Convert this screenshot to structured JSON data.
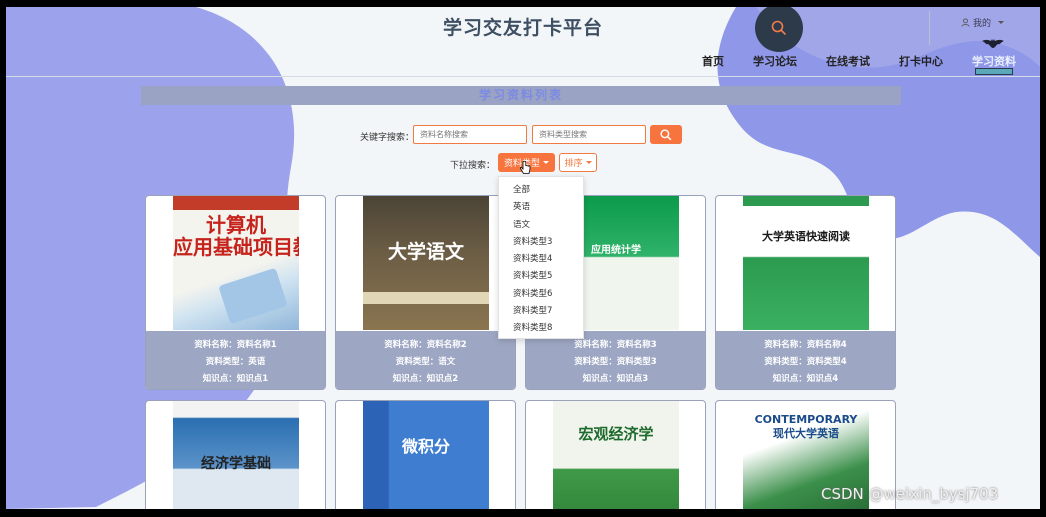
{
  "site_title": "学习交友打卡平台",
  "user_menu": {
    "label": "我的"
  },
  "nav": [
    {
      "label": "首页",
      "active": false
    },
    {
      "label": "学习论坛",
      "active": false
    },
    {
      "label": "在线考试",
      "active": false
    },
    {
      "label": "打卡中心",
      "active": false
    },
    {
      "label": "学习资料",
      "active": true
    }
  ],
  "section_title": "学习资料列表",
  "search": {
    "keyword_label": "关键字搜索：",
    "name_placeholder": "资料名称搜索",
    "type_placeholder": "资料类型搜索",
    "dropdown_label": "下拉搜索：",
    "type_button": "资料类型",
    "sort_button": "排序"
  },
  "type_dropdown": {
    "options": [
      "全部",
      "英语",
      "语文",
      "资料类型3",
      "资料类型4",
      "资料类型5",
      "资料类型6",
      "资料类型7",
      "资料类型8"
    ]
  },
  "cards": [
    {
      "name": "资料名称：资料名称1",
      "type": "资料类型：英语",
      "point": "知识点：知识点1",
      "cover": "计算机\n应用基础项目教程"
    },
    {
      "name": "资料名称：资料名称2",
      "type": "资料类型：语文",
      "point": "知识点：知识点2",
      "cover": "大学语文"
    },
    {
      "name": "资料名称：资料名称3",
      "type": "资料类型：资料类型3",
      "point": "知识点：知识点3",
      "cover": "应用统计学"
    },
    {
      "name": "资料名称：资料名称4",
      "type": "资料类型：资料类型4",
      "point": "知识点：知识点4",
      "cover": "大学英语快速阅读"
    },
    {
      "cover": "经济学基础"
    },
    {
      "cover": "微积分"
    },
    {
      "cover": "宏观经济学"
    },
    {
      "cover": "CONTEMPORARY 现代大学英语"
    }
  ],
  "watermark": "CSDN @weixin_bysj703",
  "colors": {
    "accent": "#f7743f",
    "section_bar": "#9aa3c3",
    "card_info": "#9da7c3",
    "blob": "#8f97e8"
  }
}
